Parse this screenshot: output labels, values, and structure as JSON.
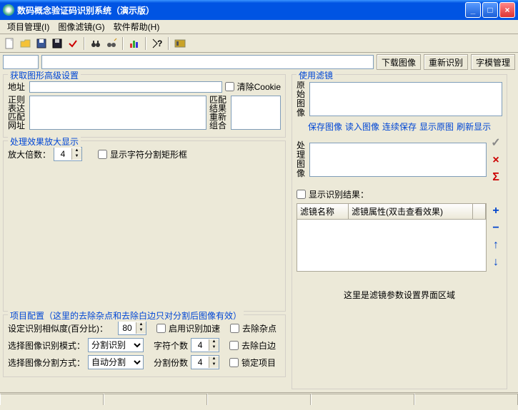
{
  "window": {
    "title": "数码概念验证码识别系统（演示版）"
  },
  "menu": {
    "project": "项目管理(I)",
    "filter": "图像滤镜(G)",
    "help": "软件帮助(H)"
  },
  "toolbar": {
    "new": "new",
    "open": "open",
    "save": "save",
    "save2": "save2",
    "check": "check",
    "find": "find",
    "find2": "find2",
    "chart": "chart",
    "help": "help",
    "tool": "tool"
  },
  "urlbar": {
    "download": "下载图像",
    "rerecognize": "重新识别",
    "fontmgr": "字模管理"
  },
  "group_capture": {
    "legend": "获取图形高级设置",
    "addr_label": "地址",
    "clear_cookie": "清除Cookie",
    "regex_label": "正则\n表达\n匹配\n网址",
    "match_label": "匹配\n结果\n重新\n组合"
  },
  "group_zoom": {
    "legend": "处理效果放大显示",
    "zoom_label": "放大倍数：",
    "zoom_value": "4",
    "show_rect": "显示字符分割矩形框"
  },
  "group_project": {
    "legend": "项目配置（这里的去除杂点和去除白边只对分割后图像有效）",
    "similarity_label": "设定识别相似度(百分比)：",
    "similarity_value": "80",
    "accel": "启用识别加速",
    "noise": "去除杂点",
    "mode_label": "选择图像识别模式：",
    "mode_value": "分割识别",
    "chars_label": "字符个数",
    "chars_value": "4",
    "trim": "去除白边",
    "split_label": "选择图像分割方式：",
    "split_value": "自动分割",
    "parts_label": "分割份数",
    "parts_value": "4",
    "lock": "锁定项目"
  },
  "group_filter": {
    "legend": "使用滤镜",
    "orig_label": "原\n始\n图\n像",
    "proc_label": "处\n理\n图\n像",
    "save_img": "保存图像",
    "load_img": "读入图像",
    "cont_save": "连续保存",
    "show_orig": "显示原图",
    "refresh": "刷新显示",
    "show_result": "显示识别结果：",
    "th_name": "滤镜名称",
    "th_attr": "滤镜属性(双击查看效果)",
    "param_hint": "这里是滤镜参数设置界面区域"
  },
  "side": {
    "check": "✓",
    "close": "×",
    "sigma": "Σ",
    "plus": "+",
    "minus": "−",
    "up": "↑",
    "down": "↓"
  }
}
